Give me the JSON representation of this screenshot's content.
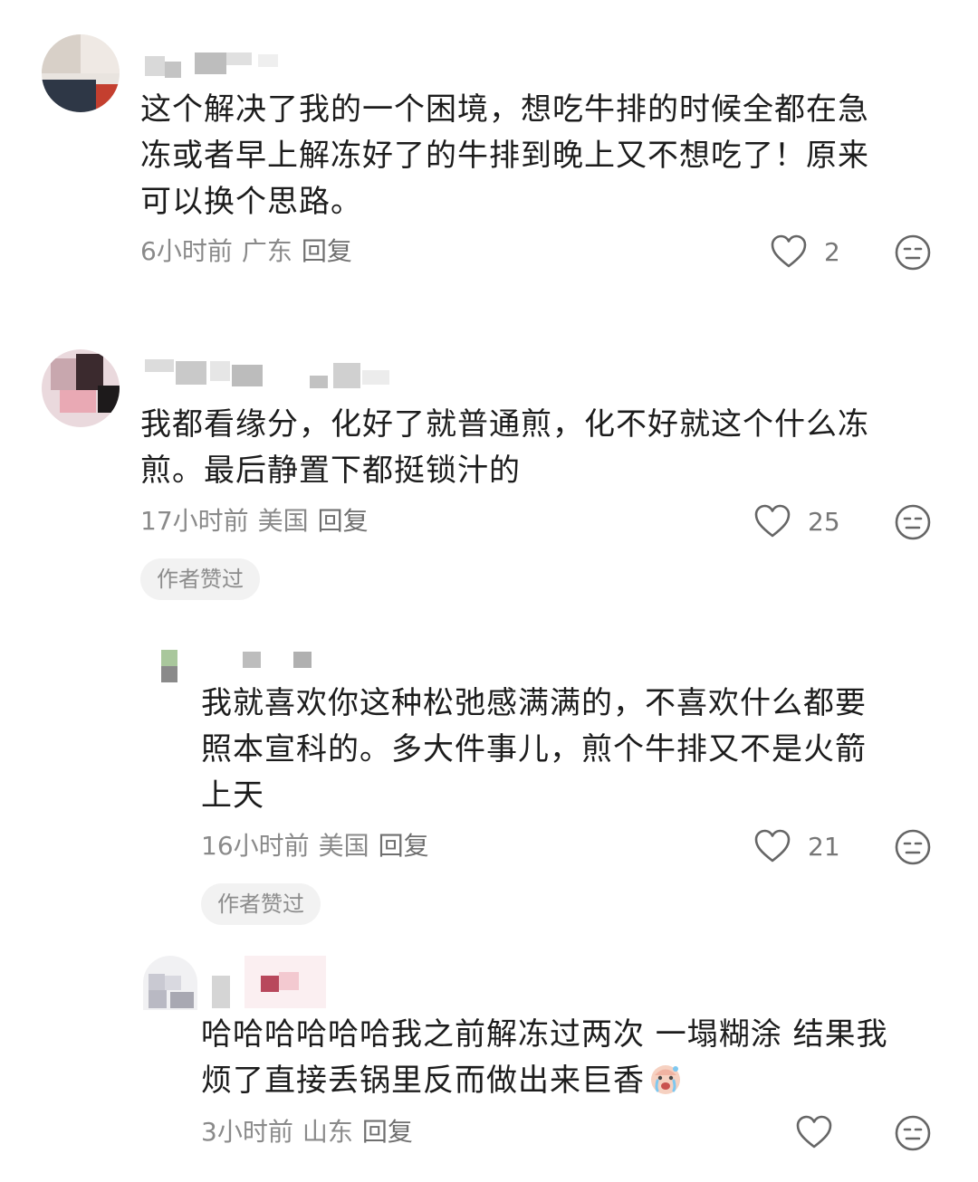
{
  "comments": [
    {
      "text_lines": [
        "这个解决了我的一个困境，想吃牛排的时候全都在急",
        "冻或者早上解冻好了的牛排到晚上又不想吃了！原来",
        "可以换个思路。"
      ],
      "time": "6小时前",
      "location": "广东",
      "reply_label": "回复",
      "likes": "2"
    },
    {
      "text_lines": [
        "我都看缘分，化好了就普通煎，化不好就这个什么冻",
        "煎。最后静置下都挺锁汁的"
      ],
      "time": "17小时前",
      "location": "美国",
      "reply_label": "回复",
      "likes": "25",
      "badge": "作者赞过"
    },
    {
      "text_lines": [
        "我就喜欢你这种松弛感满满的，不喜欢什么都要",
        "照本宣科的。多大件事儿，煎个牛排又不是火箭",
        "上天"
      ],
      "time": "16小时前",
      "location": "美国",
      "reply_label": "回复",
      "likes": "21",
      "badge": "作者赞过"
    },
    {
      "text_lines": [
        "哈哈哈哈哈哈我之前解冻过两次 一塌糊涂 结果我",
        "烦了直接丢锅里反而做出来巨香"
      ],
      "emoji": "crying-face-emoji",
      "time": "3小时前",
      "location": "山东",
      "reply_label": "回复",
      "likes": ""
    }
  ],
  "icons": {
    "like": "heart-outline-icon",
    "dislike": "neutral-face-icon"
  },
  "colors": {
    "text": "#1c1c1c",
    "meta": "#8a8a8a",
    "badge_bg": "#f2f2f2"
  }
}
